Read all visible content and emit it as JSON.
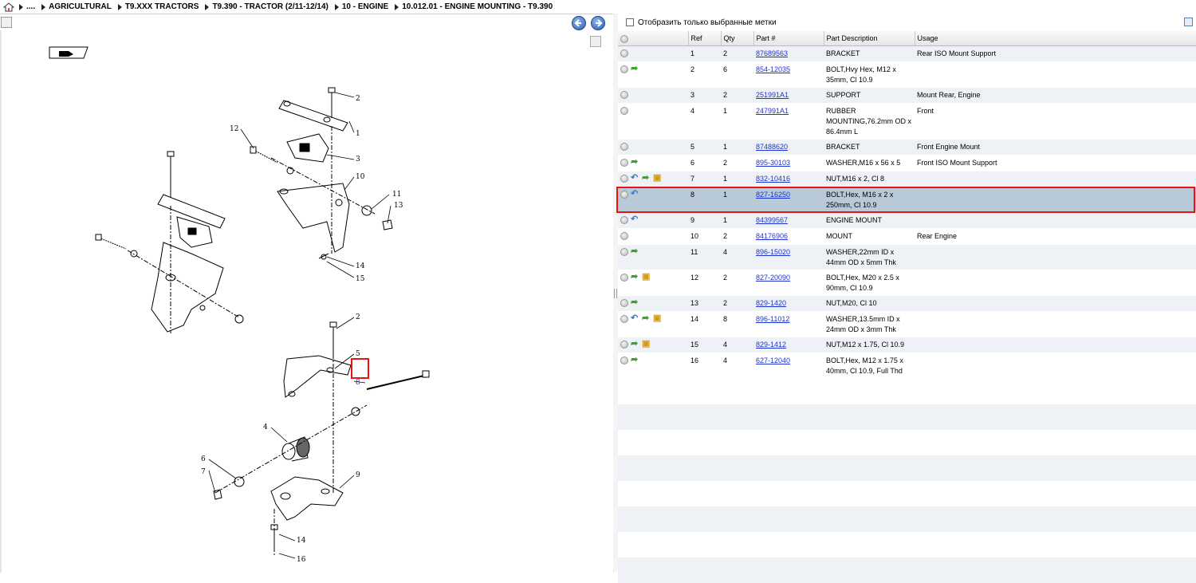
{
  "breadcrumb": {
    "ellipsis": "....",
    "items": [
      "AGRICULTURAL",
      "T9.XXX TRACTORS",
      "T9.390 - TRACTOR (2/11-12/14)",
      "10 - ENGINE",
      "10.012.01 - ENGINE MOUNTING - T9.390"
    ]
  },
  "filter": {
    "label": "Отобразить только выбранные метки"
  },
  "table": {
    "headers": {
      "ref": "Ref",
      "qty": "Qty",
      "part": "Part #",
      "desc": "Part Description",
      "usage": "Usage"
    },
    "rows": [
      {
        "ref": "1",
        "qty": "2",
        "part": "87689563",
        "desc": "BRACKET",
        "usage": "Rear ISO Mount Support",
        "icons": []
      },
      {
        "ref": "2",
        "qty": "6",
        "part": "854-12035",
        "desc": "BOLT,Hvy Hex, M12 x 35mm, Cl 10.9",
        "usage": "",
        "icons": [
          "green"
        ]
      },
      {
        "ref": "3",
        "qty": "2",
        "part": "251991A1",
        "desc": "SUPPORT",
        "usage": "Mount Rear, Engine",
        "icons": []
      },
      {
        "ref": "4",
        "qty": "1",
        "part": "247991A1",
        "desc": "RUBBER MOUNTING,76.2mm OD x 86.4mm L",
        "usage": "Front",
        "icons": []
      },
      {
        "ref": "5",
        "qty": "1",
        "part": "87488620",
        "desc": "BRACKET",
        "usage": "Front Engine Mount",
        "icons": []
      },
      {
        "ref": "6",
        "qty": "2",
        "part": "895-30103",
        "desc": "WASHER,M16 x 56 x 5",
        "usage": "Front ISO Mount Support",
        "icons": [
          "green"
        ]
      },
      {
        "ref": "7",
        "qty": "1",
        "part": "832-10416",
        "desc": "NUT,M16 x 2, Cl 8",
        "usage": "",
        "icons": [
          "blue",
          "green",
          "box"
        ]
      },
      {
        "ref": "8",
        "qty": "1",
        "part": "827-16250",
        "desc": "BOLT,Hex, M16 x 2 x 250mm, Cl 10.9",
        "usage": "",
        "icons": [
          "blue"
        ],
        "selected": true
      },
      {
        "ref": "9",
        "qty": "1",
        "part": "84399567",
        "desc": "ENGINE MOUNT",
        "usage": "",
        "icons": [
          "blue"
        ]
      },
      {
        "ref": "10",
        "qty": "2",
        "part": "84176906",
        "desc": "MOUNT",
        "usage": "Rear Engine",
        "icons": []
      },
      {
        "ref": "11",
        "qty": "4",
        "part": "896-15020",
        "desc": "WASHER,22mm ID x 44mm OD x 5mm Thk",
        "usage": "",
        "icons": [
          "green"
        ]
      },
      {
        "ref": "12",
        "qty": "2",
        "part": "827-20090",
        "desc": "BOLT,Hex, M20 x 2.5 x 90mm, Cl 10.9",
        "usage": "",
        "icons": [
          "green",
          "box"
        ]
      },
      {
        "ref": "13",
        "qty": "2",
        "part": "829-1420",
        "desc": "NUT,M20, Cl 10",
        "usage": "",
        "icons": [
          "green"
        ]
      },
      {
        "ref": "14",
        "qty": "8",
        "part": "896-11012",
        "desc": "WASHER,13.5mm ID x 24mm OD x 3mm Thk",
        "usage": "",
        "icons": [
          "blue",
          "green",
          "box"
        ]
      },
      {
        "ref": "15",
        "qty": "4",
        "part": "829-1412",
        "desc": "NUT,M12 x 1.75, Cl 10.9",
        "usage": "",
        "icons": [
          "green",
          "box"
        ]
      },
      {
        "ref": "16",
        "qty": "4",
        "part": "627-12040",
        "desc": "BOLT,Hex, M12 x 1.75 x 40mm, Cl 10.9, Full Thd",
        "usage": "",
        "icons": [
          "green"
        ]
      }
    ]
  },
  "diagram": {
    "callouts": [
      "2",
      "1",
      "3",
      "12",
      "10",
      "11",
      "13",
      "14",
      "15",
      "2",
      "5",
      "8",
      "4",
      "6",
      "7",
      "9",
      "14",
      "16"
    ]
  }
}
